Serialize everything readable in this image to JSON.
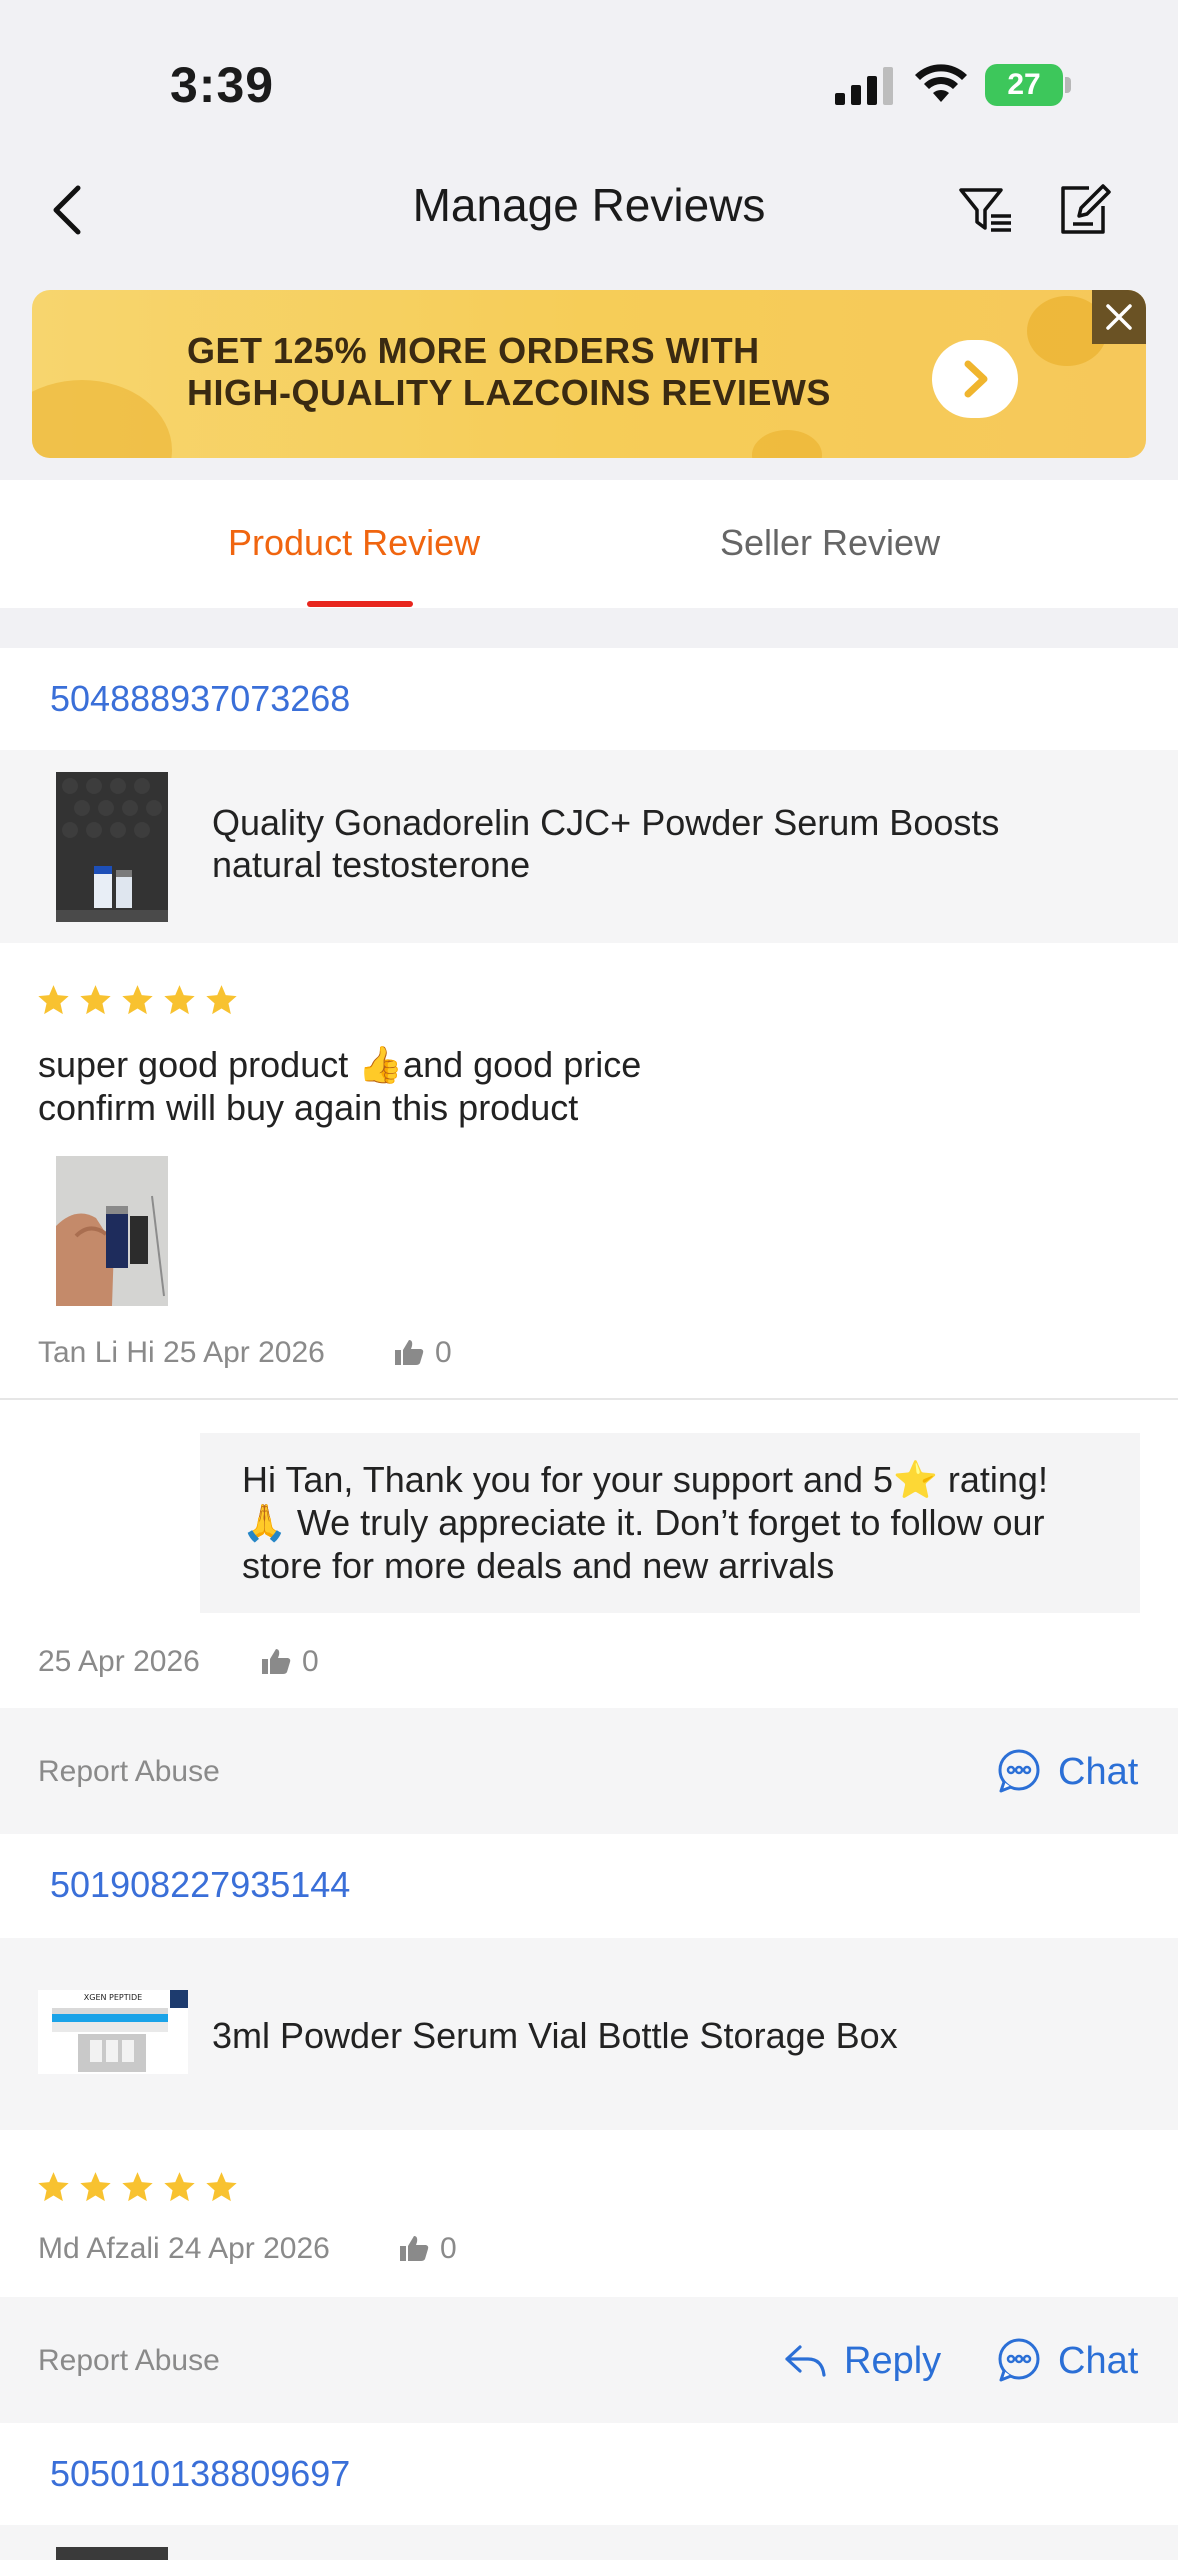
{
  "status": {
    "time": "3:39",
    "battery": "27"
  },
  "header": {
    "title": "Manage Reviews"
  },
  "banner": {
    "line1": "GET 125% MORE ORDERS WITH",
    "line2": "HIGH-QUALITY LAZCOINS REVIEWS"
  },
  "tabs": [
    {
      "label": "Product Review",
      "active": true
    },
    {
      "label": "Seller Review",
      "active": false
    }
  ],
  "reviews": [
    {
      "order_id": "504888937073268",
      "product_name_line1": "Quality Gonadorelin  CJC+ Powder Serum Boosts",
      "product_name_line2": "natural testosterone",
      "rating": 5,
      "text_line1": "super good product 👍and good price",
      "text_line2": "confirm will buy again this product",
      "author_date": "Tan Li Hi 25 Apr 2026",
      "likes": "0",
      "seller_reply": {
        "line1": "Hi Tan, Thank you for your support and 5⭐ rating!",
        "line2": "🙏 We truly appreciate it. Don’t forget to follow our",
        "line3": "store for more deals and new arrivals",
        "date": "25 Apr 2026",
        "likes": "0"
      },
      "report_label": "Report Abuse",
      "chat_label": "Chat"
    },
    {
      "order_id": "501908227935144",
      "product_name_line1": "3ml Powder Serum Vial Bottle Storage Box",
      "thumb_caption": "XGEN PEPTIDE",
      "rating": 5,
      "author_date": "Md Afzali 24 Apr 2026",
      "likes": "0",
      "report_label": "Report Abuse",
      "reply_label": "Reply",
      "chat_label": "Chat"
    },
    {
      "order_id": "505010138809697"
    }
  ],
  "colors": {
    "accent": "#f0650f",
    "link": "#2b6fd6",
    "star": "#f8c230",
    "underline": "#e8261e"
  }
}
